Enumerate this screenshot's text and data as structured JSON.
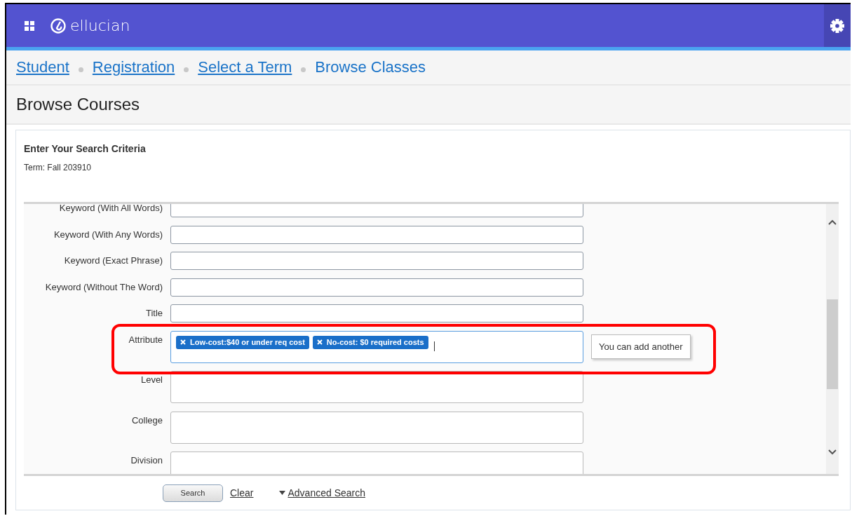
{
  "header": {
    "brand": "ellucian"
  },
  "breadcrumbs": [
    {
      "label": "Student",
      "link": true
    },
    {
      "label": "Registration",
      "link": true
    },
    {
      "label": "Select a Term",
      "link": true
    },
    {
      "label": "Browse Classes",
      "link": false
    }
  ],
  "page_title": "Browse Courses",
  "criteria": {
    "heading": "Enter Your Search Criteria",
    "term": "Term: Fall 203910"
  },
  "fields": [
    {
      "label": "Keyword (With All Words)",
      "kind": "text"
    },
    {
      "label": "Keyword (With Any Words)",
      "kind": "text"
    },
    {
      "label": "Keyword (Exact Phrase)",
      "kind": "text"
    },
    {
      "label": "Keyword (Without The Word)",
      "kind": "text"
    },
    {
      "label": "Title",
      "kind": "text"
    },
    {
      "label": "Attribute",
      "kind": "tags",
      "focused": true,
      "highlighted": true,
      "tags": [
        "Low-cost:$40 or under req cost",
        "No-cost: $0 required costs"
      ],
      "tooltip": "You can add another"
    },
    {
      "label": "Level",
      "kind": "multi"
    },
    {
      "label": "College",
      "kind": "multi"
    },
    {
      "label": "Division",
      "kind": "multi"
    }
  ],
  "actions": {
    "search": "Search",
    "clear": "Clear",
    "advanced": "Advanced Search"
  }
}
